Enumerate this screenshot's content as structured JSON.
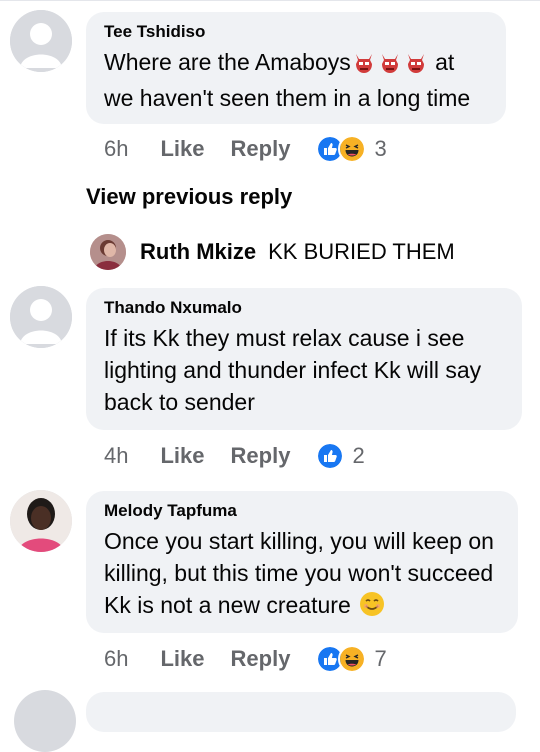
{
  "comments": [
    {
      "author": "Tee Tshidiso",
      "text_before": "Where are the Amaboys",
      "text_after": "at we haven't seen them in a long time",
      "time": "6h",
      "like_label": "Like",
      "reply_label": "Reply",
      "reaction_count": "3",
      "reaction_icons": [
        "like-icon",
        "haha-icon"
      ],
      "inline_emojis": [
        "ogre-icon",
        "ogre-icon",
        "ogre-icon"
      ]
    },
    {
      "author": "Thando Nxumalo",
      "text": "If its Kk they must relax cause i see lighting and thunder infect Kk will say back to sender",
      "time": "4h",
      "like_label": "Like",
      "reply_label": "Reply",
      "reaction_count": "2",
      "reaction_icons": [
        "like-icon"
      ]
    },
    {
      "author": "Melody Tapfuma",
      "text": "Once you start killing, you will keep on killing, but this time you won't succeed Kk is not a new creature",
      "time": "6h",
      "like_label": "Like",
      "reply_label": "Reply",
      "reaction_count": "7",
      "reaction_icons": [
        "like-icon",
        "haha-icon"
      ],
      "inline_emojis": [
        "smiling-face-icon"
      ]
    }
  ],
  "view_previous": "View previous reply",
  "reply_preview": {
    "author": "Ruth Mkize",
    "text": "KK BURIED THEM"
  },
  "colors": {
    "bubble": "#f0f2f5",
    "meta_text": "#65676b",
    "like_blue": "#1877f2",
    "haha_yellow": "#f7b125"
  }
}
